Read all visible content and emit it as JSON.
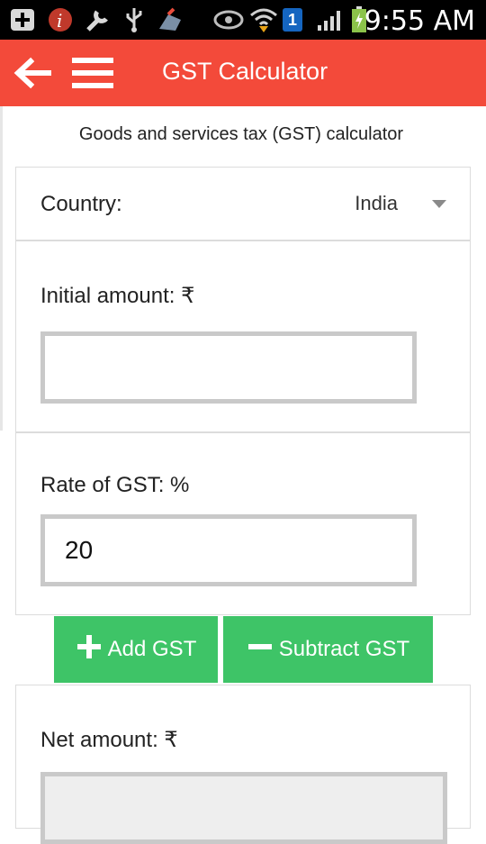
{
  "status_bar": {
    "time": "9:55 AM",
    "sim_badge": "1",
    "icons": [
      "add-box-icon",
      "app-badge-icon",
      "wrench-icon",
      "usb-icon",
      "paint-icon",
      "eye-icon",
      "wifi-icon",
      "sim-icon",
      "signal-icon",
      "battery-charging-icon"
    ]
  },
  "app_bar": {
    "title": "GST Calculator",
    "back_icon": "arrow-left-icon",
    "menu_icon": "hamburger-menu-icon",
    "color": "#f34a3a"
  },
  "subtitle": "Goods and services tax (GST) calculator",
  "country": {
    "label": "Country:",
    "value": "India"
  },
  "initial_amount": {
    "label": "Initial amount: ₹",
    "value": ""
  },
  "rate": {
    "label": "Rate of GST: %",
    "value": "20"
  },
  "buttons": {
    "add_label": "Add GST",
    "subtract_label": "Subtract GST",
    "color": "#3ec467"
  },
  "net_amount": {
    "label": "Net amount: ₹",
    "value": ""
  }
}
